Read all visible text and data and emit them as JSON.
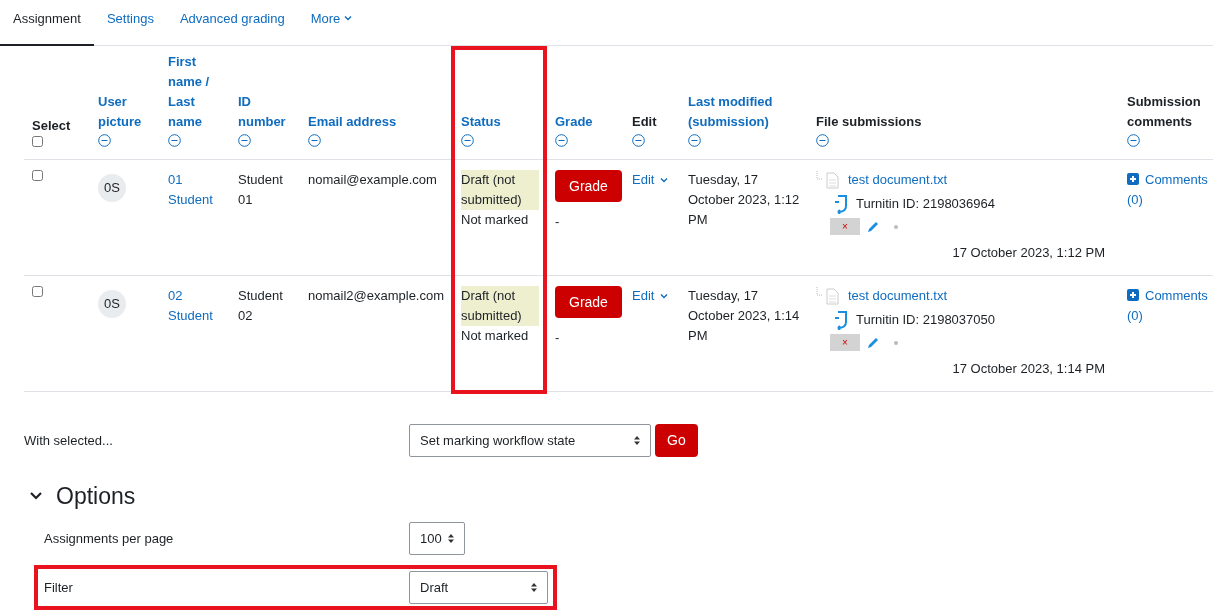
{
  "tabs": [
    {
      "label": "Assignment",
      "selected": true
    },
    {
      "label": "Settings",
      "selected": false
    },
    {
      "label": "Advanced grading",
      "selected": false
    },
    {
      "label": "More",
      "selected": false,
      "kind": "menu"
    }
  ],
  "table": {
    "select_all_checked": false,
    "columns": [
      {
        "label": "Select",
        "kind": "select",
        "sortable": false,
        "highlighted": false
      },
      {
        "label": "User picture",
        "sortable": true,
        "highlighted": false
      },
      {
        "label": "First name / Last name",
        "sortable": true,
        "highlighted": false
      },
      {
        "label": "ID number",
        "sortable": true,
        "highlighted": false
      },
      {
        "label": "Email address",
        "sortable": true,
        "highlighted": false
      },
      {
        "label": "Status",
        "sortable": true,
        "highlighted": true
      },
      {
        "label": "Grade",
        "sortable": true,
        "highlighted": false
      },
      {
        "label": "Edit",
        "sortable": false,
        "highlighted": false
      },
      {
        "label": "Last modified (submission)",
        "sortable": true,
        "highlighted": false
      },
      {
        "label": "File submissions",
        "sortable": false,
        "highlighted": false
      },
      {
        "label": "Submission comments",
        "sortable": false,
        "highlighted": false
      }
    ],
    "rows": [
      {
        "checked": false,
        "initials": "0S",
        "name": "01 Student",
        "id_number": "Student 01",
        "email": "nomail@example.com",
        "status": "Draft (not submitted)",
        "marking": "Not marked",
        "grade_button": "Grade",
        "grade": "-",
        "edit": "Edit",
        "last_modified": "Tuesday, 17 October 2023, 1:12 PM",
        "file": "test document.txt",
        "turnitin": "Turnitin ID: 2198036964",
        "score_mark": "×",
        "file_date": "17 October 2023, 1:12 PM",
        "comments": "Comments (0)"
      },
      {
        "checked": false,
        "initials": "0S",
        "name": "02 Student",
        "id_number": "Student 02",
        "email": "nomail2@example.com",
        "status": "Draft (not submitted)",
        "marking": "Not marked",
        "grade_button": "Grade",
        "grade": "-",
        "edit": "Edit",
        "last_modified": "Tuesday, 17 October 2023, 1:14 PM",
        "file": "test document.txt",
        "turnitin": "Turnitin ID: 2198037050",
        "score_mark": "×",
        "file_date": "17 October 2023, 1:14 PM",
        "comments": "Comments (0)"
      }
    ]
  },
  "bulk": {
    "label": "With selected...",
    "select": "Set marking workflow state",
    "button": "Go"
  },
  "options": {
    "title": "Options",
    "expanded": true,
    "fields": [
      {
        "label": "Assignments per page",
        "value": "100",
        "highlighted": false,
        "wide": false
      },
      {
        "label": "Filter",
        "value": "Draft",
        "highlighted": true,
        "wide": true
      }
    ]
  }
}
